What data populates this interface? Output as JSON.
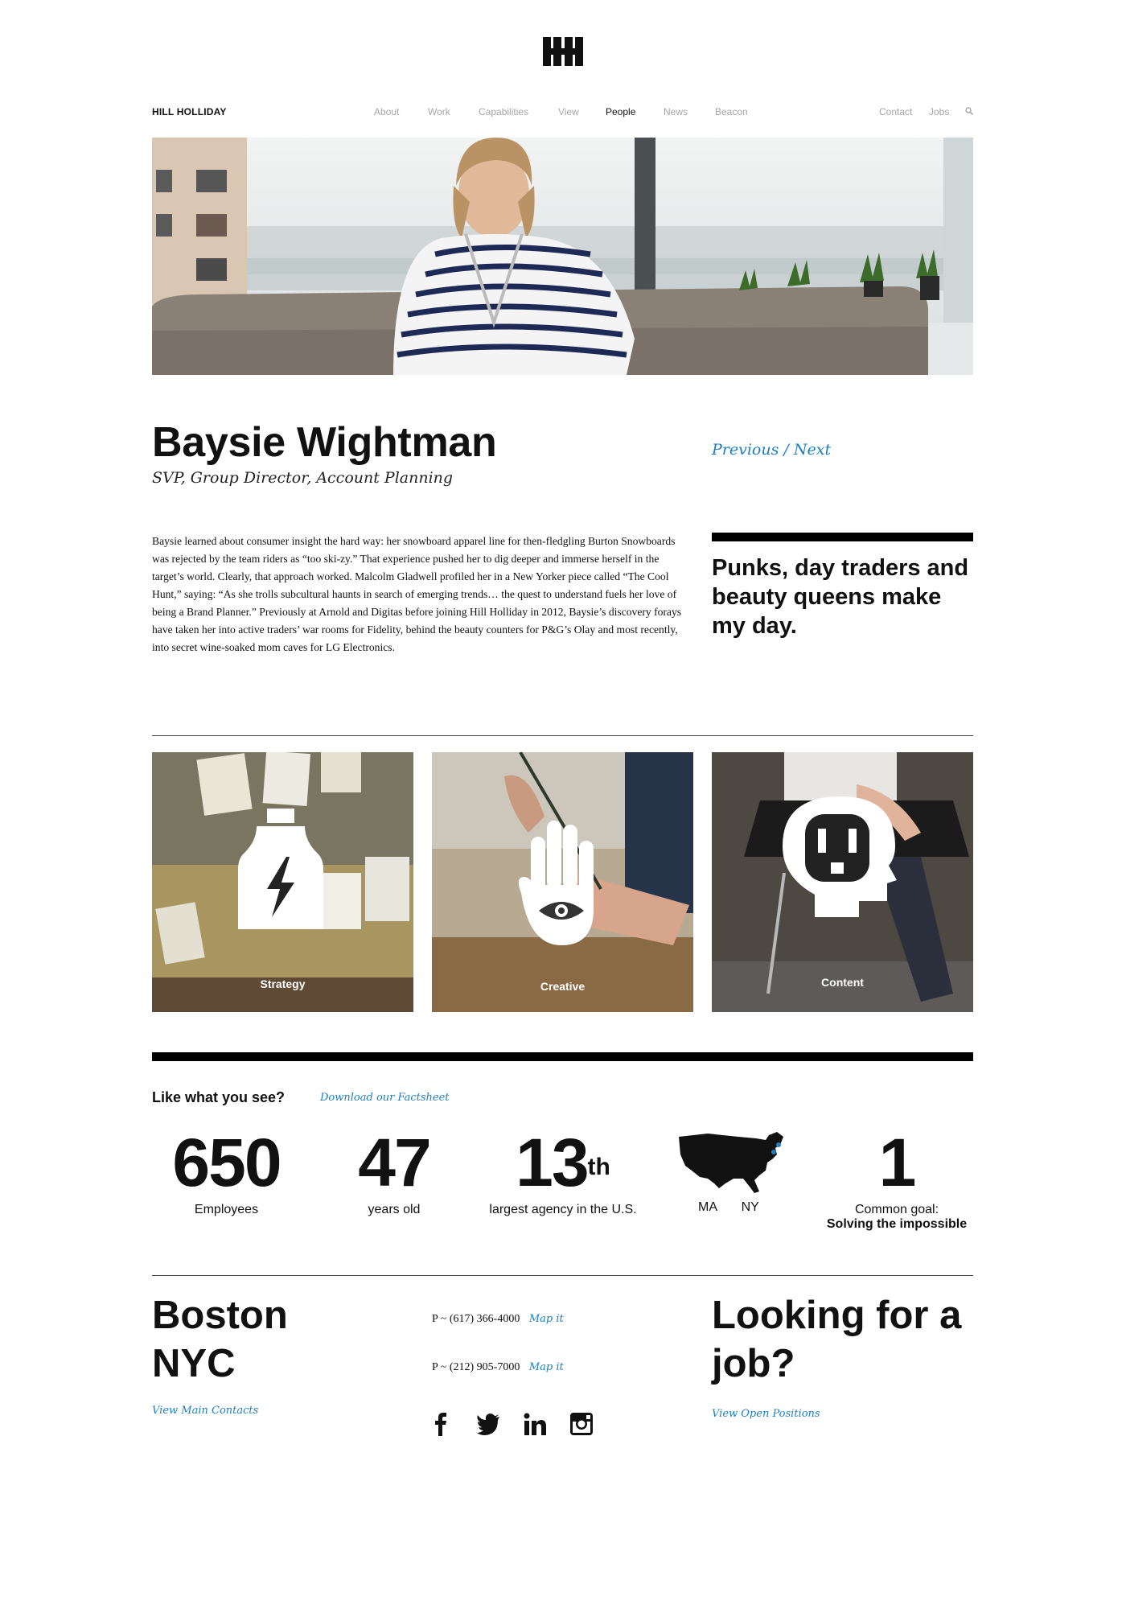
{
  "nav": {
    "brand": "HILL HOLLIDAY",
    "items": [
      {
        "label": "About"
      },
      {
        "label": "Work"
      },
      {
        "label": "Capabilities"
      },
      {
        "label": "View"
      },
      {
        "label": "People",
        "active": true
      },
      {
        "label": "News"
      },
      {
        "label": "Beacon"
      }
    ],
    "right": [
      {
        "label": "Contact"
      },
      {
        "label": "Jobs"
      }
    ]
  },
  "profile": {
    "name": "Baysie Wightman",
    "title": "SVP, Group Director, Account Planning",
    "previous": "Previous",
    "separator": "/",
    "next": "Next",
    "bio": "Baysie learned about consumer insight the hard way: her snowboard apparel line for then-fledgling Burton Snowboards was rejected by the team riders as “too ski-zy.” That experience pushed her to dig deeper and immerse herself in the target’s world. Clearly, that approach worked. Malcolm Gladwell profiled her in a New Yorker piece called “The Cool Hunt,” saying: “As she trolls subcultural haunts in search of emerging trends… the quest to understand fuels her love of being a Brand Planner.” Previously at Arnold and Digitas before joining Hill Holliday in 2012, Baysie’s discovery forays have taken her into active traders’ war rooms for Fidelity, behind the beauty counters for P&G’s Olay and most recently, into secret wine-soaked mom caves for LG Electronics.",
    "quote": "Punks, day traders and beauty queens make my day."
  },
  "tiles": [
    {
      "label": "Strategy",
      "icon": "bottle-bolt-icon"
    },
    {
      "label": "Creative",
      "icon": "hand-eye-icon"
    },
    {
      "label": "Content",
      "icon": "head-outlet-icon"
    }
  ],
  "facts": {
    "heading": "Like what you see?",
    "download": "Download our Factsheet",
    "stats": [
      {
        "num": "650",
        "label": "Employees"
      },
      {
        "num": "47",
        "label": "years old"
      },
      {
        "num": "13",
        "sup": "th",
        "label": "largest agency in the U.S."
      },
      {
        "map_ma": "MA",
        "map_ny": "NY"
      },
      {
        "num": "1",
        "label": "Common goal:",
        "label2": "Solving the impossible"
      }
    ]
  },
  "footer": {
    "boston": "Boston",
    "nyc": "NYC",
    "phone_boston": "P ~ (617) 366-4000",
    "phone_nyc": "P ~ (212) 905-7000",
    "map_it": "Map it",
    "view_contacts": "View Main Contacts",
    "job_heading": "Looking for a job?",
    "view_positions": "View Open Positions"
  },
  "colors": {
    "accent": "#1d7fc2",
    "black": "#000000",
    "nav_gray": "#a6a6a6"
  }
}
